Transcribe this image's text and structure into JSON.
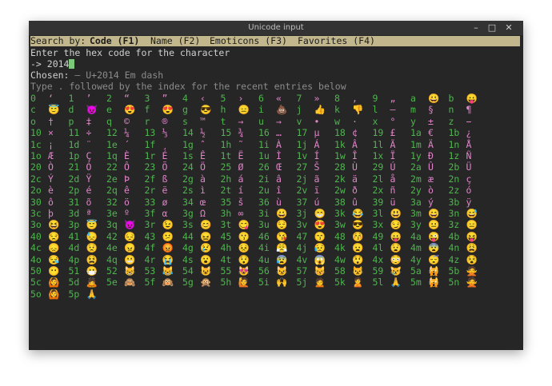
{
  "window": {
    "title": "Unicode input",
    "minimize": "–",
    "maximize": "□",
    "close": "✕"
  },
  "menubar": {
    "search_by": "Search by:",
    "tabs": [
      "Code (F1)",
      "Name (F2)",
      "Emoticons (F3)",
      "Favorites (F4)"
    ],
    "active_tab": 0
  },
  "prompt": {
    "instruction": "Enter the hex code for the character",
    "arrow": "-> ",
    "input": "2014"
  },
  "chosen": {
    "label": "Chosen: ",
    "value": "— U+2014 Em dash"
  },
  "hint": "Type . followed by the index for the recent entries below",
  "colors": {
    "index": "#4fb54f",
    "char": "#e084c9",
    "menu_bg": "#c2b68c",
    "terminal_bg": "#262626"
  },
  "entries": [
    [
      "0",
      "ʻ"
    ],
    [
      "1",
      "’"
    ],
    [
      "2",
      "“"
    ],
    [
      "3",
      "”"
    ],
    [
      "4",
      "‹"
    ],
    [
      "5",
      "›"
    ],
    [
      "6",
      "«"
    ],
    [
      "7",
      "»"
    ],
    [
      "8",
      "‚"
    ],
    [
      "9",
      "„"
    ],
    [
      "a",
      "😀"
    ],
    [
      "b",
      "😛"
    ],
    [
      "c",
      "😇"
    ],
    [
      "d",
      "😈"
    ],
    [
      "e",
      "😍"
    ],
    [
      "f",
      "😍"
    ],
    [
      "g",
      "😎"
    ],
    [
      "h",
      "😑"
    ],
    [
      "i",
      "💩"
    ],
    [
      "j",
      "👍"
    ],
    [
      "k",
      "👎"
    ],
    [
      "l",
      "—"
    ],
    [
      "m",
      "§"
    ],
    [
      "n",
      "¶"
    ],
    [
      "o",
      "†"
    ],
    [
      "p",
      "‡"
    ],
    [
      "q",
      "©"
    ],
    [
      "r",
      "®"
    ],
    [
      "s",
      "™"
    ],
    [
      "t",
      "→"
    ],
    [
      "u",
      "→"
    ],
    [
      "v",
      "•"
    ],
    [
      "w",
      "·"
    ],
    [
      "x",
      "°"
    ],
    [
      "y",
      "±"
    ],
    [
      "z",
      "−"
    ],
    [
      "10",
      "×"
    ],
    [
      "11",
      "÷"
    ],
    [
      "12",
      "¼"
    ],
    [
      "13",
      "⅓"
    ],
    [
      "14",
      "½"
    ],
    [
      "15",
      "¾"
    ],
    [
      "16",
      "…"
    ],
    [
      "17",
      "µ"
    ],
    [
      "18",
      "¢"
    ],
    [
      "19",
      "£"
    ],
    [
      "1a",
      "€"
    ],
    [
      "1b",
      "¿"
    ],
    [
      "1c",
      "¡"
    ],
    [
      "1d",
      "¨"
    ],
    [
      "1e",
      "´"
    ],
    [
      "1f",
      "¸"
    ],
    [
      "1g",
      "ˆ"
    ],
    [
      "1h",
      "˜"
    ],
    [
      "1i",
      "À"
    ],
    [
      "1j",
      "Á"
    ],
    [
      "1k",
      "Â"
    ],
    [
      "1l",
      "Ã"
    ],
    [
      "1m",
      "Ä"
    ],
    [
      "1n",
      "Å"
    ],
    [
      "1o",
      "Æ"
    ],
    [
      "1p",
      "Ç"
    ],
    [
      "1q",
      "È"
    ],
    [
      "1r",
      "É"
    ],
    [
      "1s",
      "Ê"
    ],
    [
      "1t",
      "Ë"
    ],
    [
      "1u",
      "Ì"
    ],
    [
      "1v",
      "Í"
    ],
    [
      "1w",
      "Î"
    ],
    [
      "1x",
      "Ï"
    ],
    [
      "1y",
      "Ð"
    ],
    [
      "1z",
      "Ñ"
    ],
    [
      "20",
      "Ò"
    ],
    [
      "21",
      "Ó"
    ],
    [
      "22",
      "Ô"
    ],
    [
      "23",
      "Õ"
    ],
    [
      "24",
      "Ö"
    ],
    [
      "25",
      "Ø"
    ],
    [
      "26",
      "Œ"
    ],
    [
      "27",
      "Š"
    ],
    [
      "28",
      "Ù"
    ],
    [
      "29",
      "Ú"
    ],
    [
      "2a",
      "Û"
    ],
    [
      "2b",
      "Ü"
    ],
    [
      "2c",
      "Ý"
    ],
    [
      "2d",
      "Ÿ"
    ],
    [
      "2e",
      "Þ"
    ],
    [
      "2f",
      "ß"
    ],
    [
      "2g",
      "à"
    ],
    [
      "2h",
      "á"
    ],
    [
      "2i",
      "â"
    ],
    [
      "2j",
      "ã"
    ],
    [
      "2k",
      "ä"
    ],
    [
      "2l",
      "å"
    ],
    [
      "2m",
      "æ"
    ],
    [
      "2n",
      "ç"
    ],
    [
      "2o",
      "è"
    ],
    [
      "2p",
      "é"
    ],
    [
      "2q",
      "ê"
    ],
    [
      "2r",
      "ë"
    ],
    [
      "2s",
      "ì"
    ],
    [
      "2t",
      "í"
    ],
    [
      "2u",
      "î"
    ],
    [
      "2v",
      "ï"
    ],
    [
      "2w",
      "ð"
    ],
    [
      "2x",
      "ñ"
    ],
    [
      "2y",
      "ò"
    ],
    [
      "2z",
      "ó"
    ],
    [
      "30",
      "ô"
    ],
    [
      "31",
      "õ"
    ],
    [
      "32",
      "ö"
    ],
    [
      "33",
      "ø"
    ],
    [
      "34",
      "œ"
    ],
    [
      "35",
      "š"
    ],
    [
      "36",
      "ù"
    ],
    [
      "37",
      "ú"
    ],
    [
      "38",
      "û"
    ],
    [
      "39",
      "ü"
    ],
    [
      "3a",
      "ý"
    ],
    [
      "3b",
      "ÿ"
    ],
    [
      "3c",
      "þ"
    ],
    [
      "3d",
      "ª"
    ],
    [
      "3e",
      "º"
    ],
    [
      "3f",
      "α"
    ],
    [
      "3g",
      "Ω"
    ],
    [
      "3h",
      "∞"
    ],
    [
      "3i",
      "😀"
    ],
    [
      "3j",
      "😁"
    ],
    [
      "3k",
      "😂"
    ],
    [
      "3l",
      "😃"
    ],
    [
      "3m",
      "😄"
    ],
    [
      "3n",
      "😅"
    ],
    [
      "3o",
      "😆"
    ],
    [
      "3p",
      "😇"
    ],
    [
      "3q",
      "😈"
    ],
    [
      "3r",
      "😉"
    ],
    [
      "3s",
      "😊"
    ],
    [
      "3t",
      "😋"
    ],
    [
      "3u",
      "😌"
    ],
    [
      "3v",
      "😍"
    ],
    [
      "3w",
      "😎"
    ],
    [
      "3x",
      "😏"
    ],
    [
      "3y",
      "😐"
    ],
    [
      "3z",
      "😑"
    ],
    [
      "40",
      "😒"
    ],
    [
      "41",
      "😓"
    ],
    [
      "42",
      "😔"
    ],
    [
      "43",
      "😕"
    ],
    [
      "44",
      "😖"
    ],
    [
      "45",
      "😗"
    ],
    [
      "46",
      "😘"
    ],
    [
      "47",
      "😙"
    ],
    [
      "48",
      "😚"
    ],
    [
      "49",
      "😛"
    ],
    [
      "4a",
      "😜"
    ],
    [
      "4b",
      "😝"
    ],
    [
      "4c",
      "😞"
    ],
    [
      "4d",
      "😟"
    ],
    [
      "4e",
      "😠"
    ],
    [
      "4f",
      "😡"
    ],
    [
      "4g",
      "😢"
    ],
    [
      "4h",
      "😣"
    ],
    [
      "4i",
      "😤"
    ],
    [
      "4j",
      "😥"
    ],
    [
      "4k",
      "😦"
    ],
    [
      "4l",
      "😧"
    ],
    [
      "4m",
      "😨"
    ],
    [
      "4n",
      "😩"
    ],
    [
      "4o",
      "😪"
    ],
    [
      "4p",
      "😫"
    ],
    [
      "4q",
      "😬"
    ],
    [
      "4r",
      "😭"
    ],
    [
      "4s",
      "😮"
    ],
    [
      "4t",
      "😯"
    ],
    [
      "4u",
      "😰"
    ],
    [
      "4v",
      "😱"
    ],
    [
      "4w",
      "😲"
    ],
    [
      "4x",
      "😳"
    ],
    [
      "4y",
      "😴"
    ],
    [
      "4z",
      "😵"
    ],
    [
      "50",
      "😶"
    ],
    [
      "51",
      "😷"
    ],
    [
      "52",
      "😸"
    ],
    [
      "53",
      "😹"
    ],
    [
      "54",
      "😺"
    ],
    [
      "55",
      "😻"
    ],
    [
      "56",
      "😼"
    ],
    [
      "57",
      "😽"
    ],
    [
      "58",
      "😾"
    ],
    [
      "59",
      "😿"
    ],
    [
      "5a",
      "🙀"
    ],
    [
      "5b",
      "🙅"
    ],
    [
      "5c",
      "🙆"
    ],
    [
      "5d",
      "🙇"
    ],
    [
      "5e",
      "🙈"
    ],
    [
      "5f",
      "🙉"
    ],
    [
      "5g",
      "🙊"
    ],
    [
      "5h",
      "🙋"
    ],
    [
      "5i",
      "🙌"
    ],
    [
      "5j",
      "🙍"
    ],
    [
      "5k",
      "🙎"
    ],
    [
      "5l",
      "🙏"
    ],
    [
      "5m",
      "🙀"
    ],
    [
      "5n",
      "🙅"
    ],
    [
      "5o",
      "🙆"
    ],
    [
      "5p",
      "🙏"
    ]
  ]
}
